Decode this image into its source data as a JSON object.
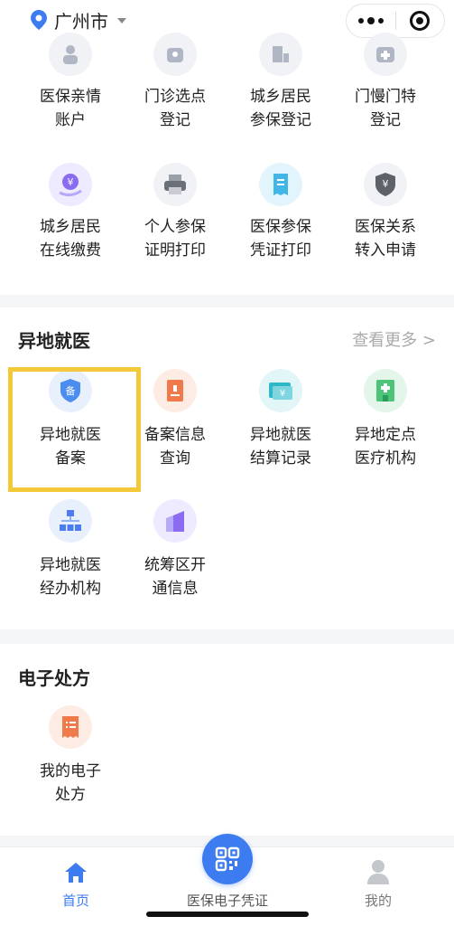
{
  "header": {
    "city": "广州市",
    "icons": [
      "location-pin-icon",
      "caret-down-icon",
      "more-dots-icon",
      "target-icon"
    ]
  },
  "top_grid": [
    {
      "line1": "医保亲情",
      "line2": "账户",
      "icon": "family-account-icon",
      "color": "#b0b6c3"
    },
    {
      "line1": "门诊选点",
      "line2": "登记",
      "icon": "clinic-select-icon",
      "color": "#b0b6c3"
    },
    {
      "line1": "城乡居民",
      "line2": "参保登记",
      "icon": "resident-register-icon",
      "color": "#b0b6c3"
    },
    {
      "line1": "门慢门特",
      "line2": "登记",
      "icon": "chronic-register-icon",
      "color": "#b0b6c3"
    },
    {
      "line1": "城乡居民",
      "line2": "在线缴费",
      "icon": "online-payment-icon",
      "color": "#8b6cf0"
    },
    {
      "line1": "个人参保",
      "line2": "证明打印",
      "icon": "printer-icon",
      "color": "#6b6f78"
    },
    {
      "line1": "医保参保",
      "line2": "凭证打印",
      "icon": "receipt-icon",
      "color": "#41b7e8"
    },
    {
      "line1": "医保关系",
      "line2": "转入申请",
      "icon": "transfer-shield-icon",
      "color": "#5d6168"
    }
  ],
  "remote": {
    "title": "异地就医",
    "more": "查看更多 >",
    "items": [
      {
        "line1": "异地就医",
        "line2": "备案",
        "icon": "shield-filing-icon",
        "color": "#4c8df0",
        "badge": "备"
      },
      {
        "line1": "备案信息",
        "line2": "查询",
        "icon": "document-query-icon",
        "color": "#f07a4c"
      },
      {
        "line1": "异地就医",
        "line2": "结算记录",
        "icon": "settlement-card-icon",
        "color": "#2fb8c8",
        "badge": "¥"
      },
      {
        "line1": "异地定点",
        "line2": "医疗机构",
        "icon": "hospital-icon",
        "color": "#4cc47a"
      },
      {
        "line1": "异地就医",
        "line2": "经办机构",
        "icon": "org-chart-icon",
        "color": "#4c7cf0"
      },
      {
        "line1": "统筹区开",
        "line2": "通信息",
        "icon": "bar-chart-icon",
        "color": "#8b6cf0"
      }
    ]
  },
  "eprescription": {
    "title": "电子处方",
    "items": [
      {
        "line1": "我的电子",
        "line2": "处方",
        "icon": "prescription-icon",
        "color": "#f07a4c"
      }
    ]
  },
  "nav": {
    "home": "首页",
    "center": "医保电子凭证",
    "mine": "我的",
    "active_color": "#3d7cf0"
  }
}
